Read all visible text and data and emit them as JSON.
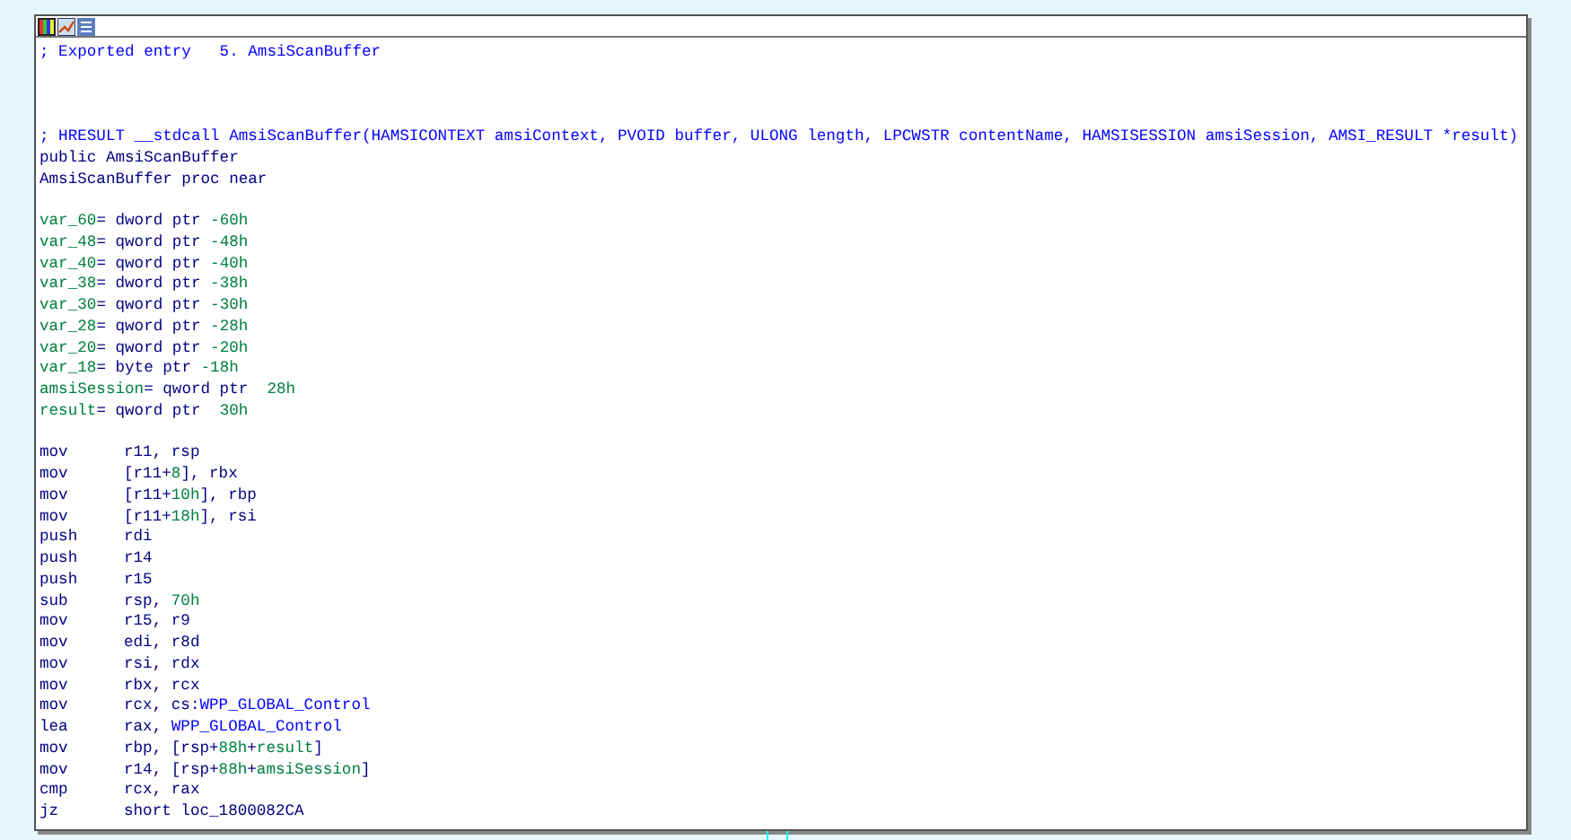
{
  "lines": [
    {
      "kind": "code",
      "tokens": [
        {
          "kind": "comment",
          "text": "; Exported entry   5. AmsiScanBuffer"
        }
      ]
    },
    {
      "kind": "blank"
    },
    {
      "kind": "blank"
    },
    {
      "kind": "blank"
    },
    {
      "kind": "code",
      "tokens": [
        {
          "kind": "comment",
          "text": "; HRESULT __stdcall AmsiScanBuffer(HAMSICONTEXT amsiContext, PVOID buffer, ULONG length, LPCWSTR contentName, HAMSISESSION amsiSession, AMSI_RESULT *result)"
        }
      ]
    },
    {
      "kind": "code",
      "tokens": [
        {
          "kind": "text",
          "text": "public AmsiScanBuffer"
        }
      ]
    },
    {
      "kind": "code",
      "tokens": [
        {
          "kind": "text",
          "text": "AmsiScanBuffer proc near"
        }
      ]
    },
    {
      "kind": "blank"
    },
    {
      "kind": "code",
      "tokens": [
        {
          "kind": "var",
          "text": "var_60"
        },
        {
          "kind": "text",
          "text": "= dword ptr "
        },
        {
          "kind": "num",
          "text": "-60h"
        }
      ]
    },
    {
      "kind": "code",
      "tokens": [
        {
          "kind": "var",
          "text": "var_48"
        },
        {
          "kind": "text",
          "text": "= qword ptr "
        },
        {
          "kind": "num",
          "text": "-48h"
        }
      ]
    },
    {
      "kind": "code",
      "tokens": [
        {
          "kind": "var",
          "text": "var_40"
        },
        {
          "kind": "text",
          "text": "= qword ptr "
        },
        {
          "kind": "num",
          "text": "-40h"
        }
      ]
    },
    {
      "kind": "code",
      "tokens": [
        {
          "kind": "var",
          "text": "var_38"
        },
        {
          "kind": "text",
          "text": "= dword ptr "
        },
        {
          "kind": "num",
          "text": "-38h"
        }
      ]
    },
    {
      "kind": "code",
      "tokens": [
        {
          "kind": "var",
          "text": "var_30"
        },
        {
          "kind": "text",
          "text": "= qword ptr "
        },
        {
          "kind": "num",
          "text": "-30h"
        }
      ]
    },
    {
      "kind": "code",
      "tokens": [
        {
          "kind": "var",
          "text": "var_28"
        },
        {
          "kind": "text",
          "text": "= qword ptr "
        },
        {
          "kind": "num",
          "text": "-28h"
        }
      ]
    },
    {
      "kind": "code",
      "tokens": [
        {
          "kind": "var",
          "text": "var_20"
        },
        {
          "kind": "text",
          "text": "= qword ptr "
        },
        {
          "kind": "num",
          "text": "-20h"
        }
      ]
    },
    {
      "kind": "code",
      "tokens": [
        {
          "kind": "var",
          "text": "var_18"
        },
        {
          "kind": "text",
          "text": "= byte ptr "
        },
        {
          "kind": "num",
          "text": "-18h"
        }
      ]
    },
    {
      "kind": "code",
      "tokens": [
        {
          "kind": "var",
          "text": "amsiSession"
        },
        {
          "kind": "text",
          "text": "= qword ptr  "
        },
        {
          "kind": "num",
          "text": "28h"
        }
      ]
    },
    {
      "kind": "code",
      "tokens": [
        {
          "kind": "var",
          "text": "result"
        },
        {
          "kind": "text",
          "text": "= qword ptr  "
        },
        {
          "kind": "num",
          "text": "30h"
        }
      ]
    },
    {
      "kind": "blank"
    },
    {
      "kind": "code",
      "tokens": [
        {
          "kind": "mnemonic",
          "text": "mov"
        },
        {
          "kind": "text",
          "text": "r11, rsp"
        }
      ]
    },
    {
      "kind": "code",
      "tokens": [
        {
          "kind": "mnemonic",
          "text": "mov"
        },
        {
          "kind": "text",
          "text": "[r11+"
        },
        {
          "kind": "num",
          "text": "8"
        },
        {
          "kind": "text",
          "text": "], rbx"
        }
      ]
    },
    {
      "kind": "code",
      "tokens": [
        {
          "kind": "mnemonic",
          "text": "mov"
        },
        {
          "kind": "text",
          "text": "[r11+"
        },
        {
          "kind": "num",
          "text": "10h"
        },
        {
          "kind": "text",
          "text": "], rbp"
        }
      ]
    },
    {
      "kind": "code",
      "tokens": [
        {
          "kind": "mnemonic",
          "text": "mov"
        },
        {
          "kind": "text",
          "text": "[r11+"
        },
        {
          "kind": "num",
          "text": "18h"
        },
        {
          "kind": "text",
          "text": "], rsi"
        }
      ]
    },
    {
      "kind": "code",
      "tokens": [
        {
          "kind": "mnemonic",
          "text": "push"
        },
        {
          "kind": "text",
          "text": "rdi"
        }
      ]
    },
    {
      "kind": "code",
      "tokens": [
        {
          "kind": "mnemonic",
          "text": "push"
        },
        {
          "kind": "text",
          "text": "r14"
        }
      ]
    },
    {
      "kind": "code",
      "tokens": [
        {
          "kind": "mnemonic",
          "text": "push"
        },
        {
          "kind": "text",
          "text": "r15"
        }
      ]
    },
    {
      "kind": "code",
      "tokens": [
        {
          "kind": "mnemonic",
          "text": "sub"
        },
        {
          "kind": "text",
          "text": "rsp, "
        },
        {
          "kind": "num",
          "text": "70h"
        }
      ]
    },
    {
      "kind": "code",
      "tokens": [
        {
          "kind": "mnemonic",
          "text": "mov"
        },
        {
          "kind": "text",
          "text": "r15, r9"
        }
      ]
    },
    {
      "kind": "code",
      "tokens": [
        {
          "kind": "mnemonic",
          "text": "mov"
        },
        {
          "kind": "text",
          "text": "edi, r8d"
        }
      ]
    },
    {
      "kind": "code",
      "tokens": [
        {
          "kind": "mnemonic",
          "text": "mov"
        },
        {
          "kind": "text",
          "text": "rsi, rdx"
        }
      ]
    },
    {
      "kind": "code",
      "tokens": [
        {
          "kind": "mnemonic",
          "text": "mov"
        },
        {
          "kind": "text",
          "text": "rbx, rcx"
        }
      ]
    },
    {
      "kind": "code",
      "tokens": [
        {
          "kind": "mnemonic",
          "text": "mov"
        },
        {
          "kind": "text",
          "text": "rcx, cs:"
        },
        {
          "kind": "ref",
          "text": "WPP_GLOBAL_Control"
        }
      ]
    },
    {
      "kind": "code",
      "tokens": [
        {
          "kind": "mnemonic",
          "text": "lea"
        },
        {
          "kind": "text",
          "text": "rax, "
        },
        {
          "kind": "ref",
          "text": "WPP_GLOBAL_Control"
        }
      ]
    },
    {
      "kind": "code",
      "tokens": [
        {
          "kind": "mnemonic",
          "text": "mov"
        },
        {
          "kind": "text",
          "text": "rbp, [rsp+"
        },
        {
          "kind": "num",
          "text": "88h"
        },
        {
          "kind": "text",
          "text": "+"
        },
        {
          "kind": "var",
          "text": "result"
        },
        {
          "kind": "text",
          "text": "]"
        }
      ]
    },
    {
      "kind": "code",
      "tokens": [
        {
          "kind": "mnemonic",
          "text": "mov"
        },
        {
          "kind": "text",
          "text": "r14, [rsp+"
        },
        {
          "kind": "num",
          "text": "88h"
        },
        {
          "kind": "text",
          "text": "+"
        },
        {
          "kind": "var",
          "text": "amsiSession"
        },
        {
          "kind": "text",
          "text": "]"
        }
      ]
    },
    {
      "kind": "code",
      "tokens": [
        {
          "kind": "mnemonic",
          "text": "cmp"
        },
        {
          "kind": "text",
          "text": "rcx, rax"
        }
      ]
    },
    {
      "kind": "code",
      "tokens": [
        {
          "kind": "mnemonic",
          "text": "jz"
        },
        {
          "kind": "text",
          "text": "short loc_1800082CA"
        }
      ]
    }
  ]
}
